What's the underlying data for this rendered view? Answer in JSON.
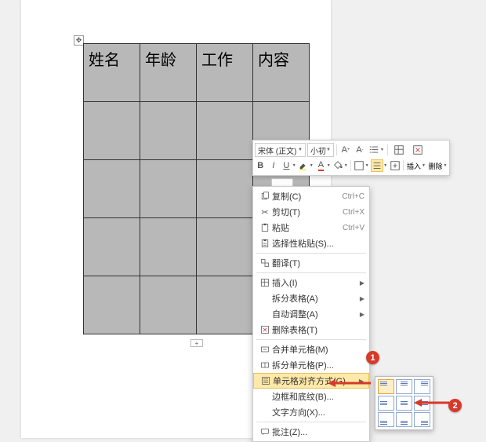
{
  "table": {
    "headers": [
      "姓名",
      "年龄",
      "工作",
      "内容"
    ]
  },
  "toolbar": {
    "font": "宋体 (正文)",
    "size": "小初",
    "insert": "插入",
    "delete": "删除"
  },
  "menu": {
    "copy": "复制(C)",
    "copy_sc": "Ctrl+C",
    "cut": "剪切(T)",
    "cut_sc": "Ctrl+X",
    "paste": "粘贴",
    "paste_sc": "Ctrl+V",
    "paste_special": "选择性粘贴(S)...",
    "translate": "翻译(T)",
    "insert": "插入(I)",
    "split_table": "拆分表格(A)",
    "autofit": "自动调整(A)",
    "delete_table": "删除表格(T)",
    "merge_cells": "合并单元格(M)",
    "split_cells": "拆分单元格(P)...",
    "cell_align": "单元格对齐方式(G)",
    "borders": "边框和底纹(B)...",
    "text_direction": "文字方向(X)...",
    "comment": "批注(Z)..."
  },
  "callouts": {
    "one": "1",
    "two": "2"
  }
}
